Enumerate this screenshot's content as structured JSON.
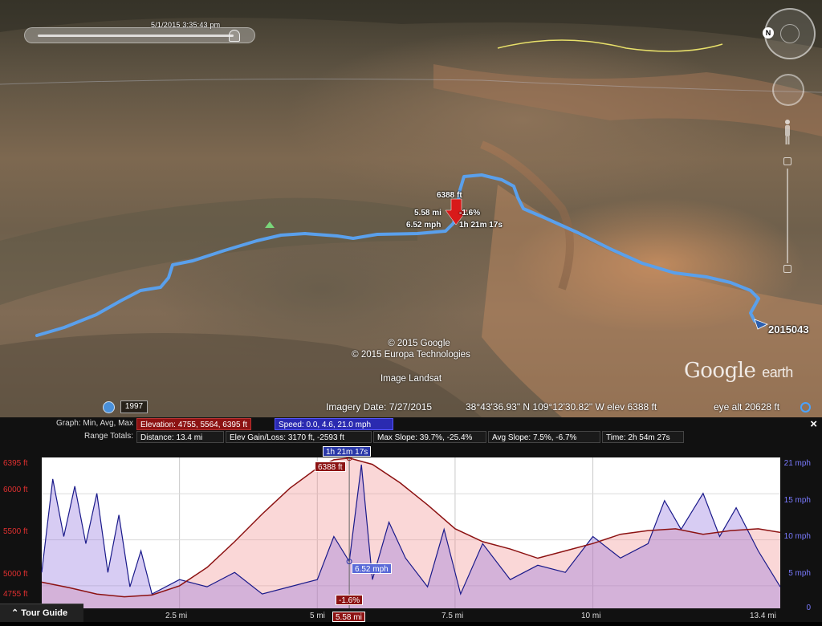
{
  "map": {
    "timeslider_label": "5/1/2015   3:35:43 pm",
    "hist_year": "1997",
    "path_label_elev": "6388 ft",
    "path_label_dist": "5.58 mi",
    "path_label_slope": "-1.6%",
    "path_label_speed": "6.52 mph",
    "path_label_time": "1h 21m 17s",
    "track_end_label": "2015043",
    "copyright_1": "© 2015 Google",
    "copyright_2": "© 2015 Europa Technologies",
    "image_credit": "Image Landsat",
    "brand_main": "Google",
    "brand_sub": "earth",
    "imagery_date": "Imagery Date: 7/27/2015",
    "coords": "38°43'36.93\" N  109°12'30.82\" W  elev  6388 ft",
    "eye_alt": "eye alt  20628 ft",
    "compass_letter": "N",
    "colors": {
      "track": "#5aa0ec",
      "road": "#e8e06a"
    }
  },
  "profile": {
    "graph_label": "Graph: Min, Avg, Max",
    "elevation_chip": "Elevation: 4755, 5564, 6395 ft",
    "speed_chip": "Speed: 0.0, 4.6, 21.0 mph",
    "totals_label": "Range Totals:",
    "distance": "Distance: 13.4 mi",
    "elev_gain": "Elev Gain/Loss: 3170 ft, -2593 ft",
    "max_slope": "Max Slope: 39.7%, -25.4%",
    "avg_slope": "Avg Slope: 7.5%, -6.7%",
    "time": "Time: 2h 54m 27s",
    "close": "×",
    "tour_guide": "Tour Guide",
    "cursor": {
      "time": "1h 21m 17s",
      "elev": "6388 ft",
      "speed": "6.52 mph",
      "slope": "-1.6%",
      "dist": "5.58 mi"
    },
    "colors": {
      "elevation": "#8c1212",
      "speed": "#1a1a8a"
    }
  },
  "chart_data": {
    "type": "line",
    "xlabel": "",
    "xlim": [
      0,
      13.4
    ],
    "x_ticks": [
      "2.5 mi",
      "5 mi",
      "5.58 mi",
      "7.5 mi",
      "10 mi",
      "13.4 mi"
    ],
    "y_left_ticks": [
      "6395 ft",
      "6000 ft",
      "5500 ft",
      "5000 ft",
      "4755 ft"
    ],
    "y_right_ticks": [
      "21 mph",
      "15 mph",
      "10 mph",
      "5 mph",
      "0"
    ],
    "ylim_left": [
      4755,
      6395
    ],
    "ylim_right": [
      0,
      21
    ],
    "series": [
      {
        "name": "Elevation",
        "axis": "left",
        "x": [
          0,
          0.5,
          1.0,
          1.5,
          2.0,
          2.5,
          3.0,
          3.5,
          4.0,
          4.5,
          5.0,
          5.3,
          5.58,
          6.0,
          6.5,
          7.0,
          7.5,
          8.0,
          8.5,
          9.0,
          9.5,
          10.0,
          10.5,
          11.0,
          11.5,
          12.0,
          12.5,
          13.0,
          13.4
        ],
        "values": [
          5040,
          4980,
          4910,
          4880,
          4900,
          5000,
          5200,
          5480,
          5780,
          6060,
          6280,
          6370,
          6388,
          6320,
          6120,
          5880,
          5620,
          5480,
          5400,
          5300,
          5380,
          5460,
          5560,
          5600,
          5620,
          5560,
          5600,
          5620,
          5580
        ]
      },
      {
        "name": "Speed",
        "axis": "right",
        "x": [
          0,
          0.2,
          0.4,
          0.6,
          0.8,
          1.0,
          1.2,
          1.4,
          1.6,
          1.8,
          2.0,
          2.5,
          3.0,
          3.5,
          4.0,
          4.5,
          5.0,
          5.3,
          5.58,
          5.8,
          6.0,
          6.3,
          6.6,
          7.0,
          7.3,
          7.6,
          8.0,
          8.5,
          9.0,
          9.5,
          10.0,
          10.5,
          11.0,
          11.3,
          11.6,
          12.0,
          12.3,
          12.6,
          13.0,
          13.4
        ],
        "values": [
          5,
          18,
          10,
          17,
          9,
          16,
          5,
          13,
          3,
          8,
          2,
          4,
          3,
          5,
          2,
          3,
          4,
          10,
          6.52,
          20,
          4,
          12,
          7,
          3,
          11,
          2,
          9,
          4,
          6,
          5,
          10,
          7,
          9,
          15,
          11,
          16,
          10,
          14,
          8,
          3
        ]
      }
    ],
    "cursor_x": 5.58
  }
}
